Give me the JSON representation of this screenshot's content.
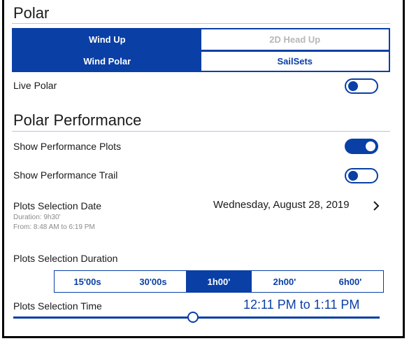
{
  "section_polar": {
    "title": "Polar",
    "view_tabs": [
      {
        "label": "Wind Up",
        "selected": true
      },
      {
        "label": "2D Head Up",
        "selected": false
      }
    ],
    "mode_tabs": [
      {
        "label": "Wind Polar",
        "selected": true
      },
      {
        "label": "SailSets",
        "selected": false
      }
    ],
    "live_polar": {
      "label": "Live Polar",
      "enabled": false
    }
  },
  "section_performance": {
    "title": "Polar Performance",
    "show_plots": {
      "label": "Show Performance Plots",
      "enabled": true
    },
    "show_trail": {
      "label": "Show Performance Trail",
      "enabled": false
    },
    "selection_date": {
      "label": "Plots Selection Date",
      "value": "Wednesday, August 28, 2019",
      "duration": "Duration: 9h30'",
      "range": "From: 8:48 AM to 6:19 PM"
    },
    "selection_duration": {
      "label": "Plots Selection Duration",
      "options": [
        "15'00s",
        "30'00s",
        "1h00'",
        "2h00'",
        "6h00'"
      ],
      "selected": "1h00'"
    },
    "selection_time": {
      "label": "Plots Selection Time",
      "value": "12:11 PM to 1:11 PM",
      "slider_fraction": 0.49
    }
  },
  "colors": {
    "accent": "#0a3fa6",
    "disabled_text": "#b7b7b7",
    "divider": "#b8c4dc"
  },
  "icons": {
    "chevron": "chevron-right-icon"
  }
}
